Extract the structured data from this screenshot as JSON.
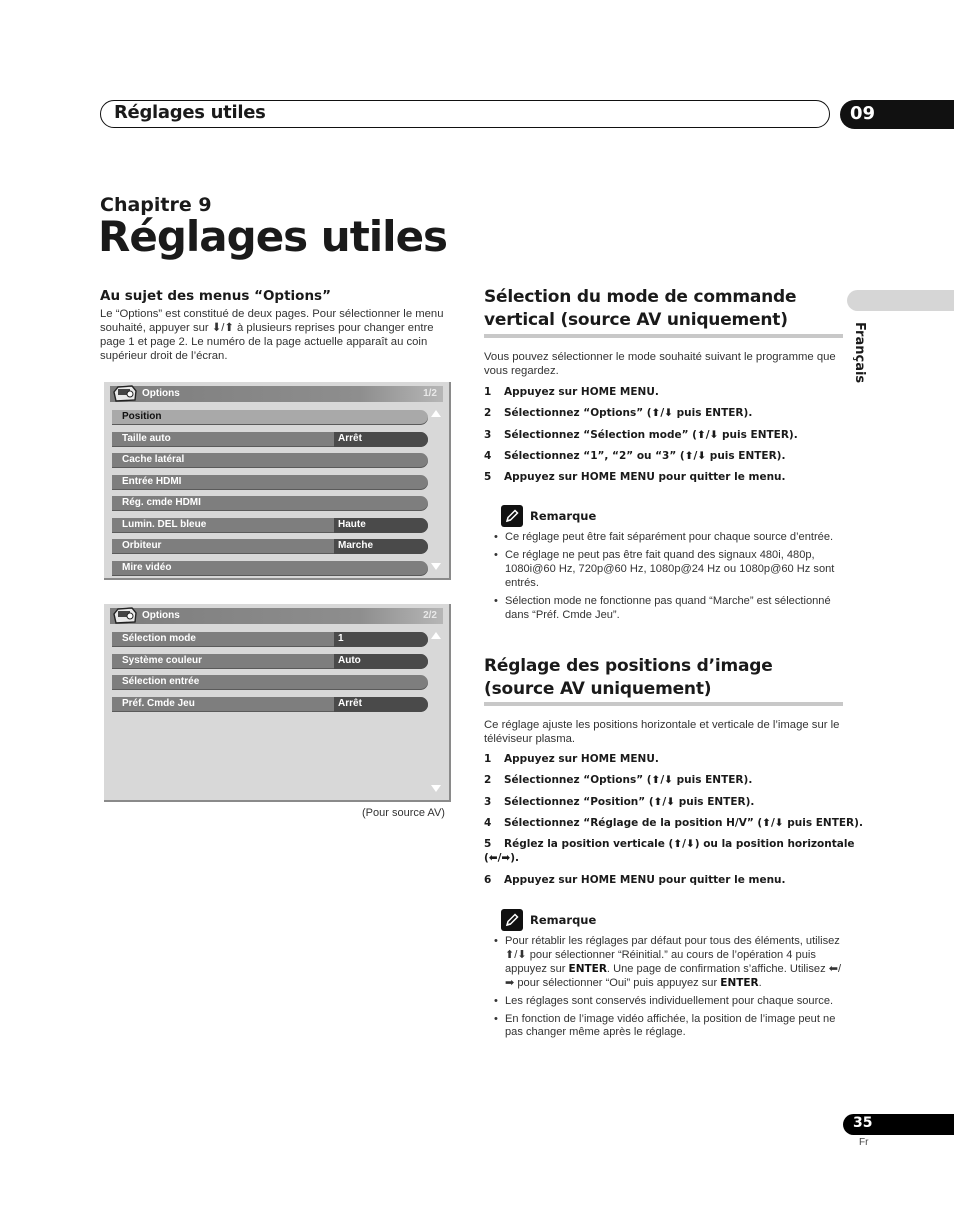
{
  "header": {
    "section_title": "Réglages utiles",
    "chapter_number": "09"
  },
  "chapter": {
    "label": "Chapitre 9",
    "title": "Réglages utiles"
  },
  "side_tab": {
    "language": "Français"
  },
  "left": {
    "heading": "Au sujet des menus “Options”",
    "paragraph": "Le “Options” est constitué de deux pages. Pour sélectionner le menu souhaité, appuyer sur ⬇/⬆ à plusieurs reprises pour changer entre page 1 et page 2. Le numéro de la page actuelle apparaît au coin supérieur droit de l’écran.",
    "menus": [
      {
        "title": "Options",
        "page": "1/2",
        "icon": "remote-control-icon",
        "rows": [
          {
            "label": "Position",
            "value": null,
            "selected": true
          },
          {
            "label": "Taille auto",
            "value": "Arrêt"
          },
          {
            "label": "Cache latéral",
            "value": null
          },
          {
            "label": "Entrée HDMI",
            "value": null
          },
          {
            "label": "Rég. cmde HDMI",
            "value": null
          },
          {
            "label": "Lumin. DEL bleue",
            "value": "Haute"
          },
          {
            "label": "Orbiteur",
            "value": "Marche"
          },
          {
            "label": "Mire vidéo",
            "value": null
          }
        ]
      },
      {
        "title": "Options",
        "page": "2/2",
        "icon": "remote-control-icon",
        "rows": [
          {
            "label": "Sélection mode",
            "value": "1"
          },
          {
            "label": "Système couleur",
            "value": "Auto"
          },
          {
            "label": "Sélection entrée",
            "value": null
          },
          {
            "label": "Préf. Cmde Jeu",
            "value": "Arrêt"
          }
        ]
      }
    ],
    "caption": "(Pour source AV)"
  },
  "right": {
    "section1": {
      "title_line1": "Sélection du mode de commande",
      "title_line2": "vertical (source AV uniquement)",
      "intro": "Vous pouvez sélectionner le mode souhaité suivant le programme que vous regardez.",
      "steps": [
        {
          "n": "1",
          "text": "Appuyez sur HOME MENU."
        },
        {
          "n": "2",
          "text": "Sélectionnez “Options” (⬆/⬇ puis ENTER)."
        },
        {
          "n": "3",
          "text": "Sélectionnez “Sélection mode” (⬆/⬇ puis ENTER)."
        },
        {
          "n": "4",
          "text": "Sélectionnez “1”, “2” ou “3” (⬆/⬇ puis ENTER)."
        },
        {
          "n": "5",
          "text": "Appuyez sur HOME MENU pour quitter le menu."
        }
      ],
      "note_heading": "Remarque",
      "notes": [
        "Ce réglage peut être fait séparément pour chaque source d’entrée.",
        "Ce réglage ne peut pas être fait quand des signaux 480i, 480p, 1080i@60 Hz, 720p@60 Hz, 1080p@24 Hz ou 1080p@60 Hz sont entrés.",
        "Sélection mode ne fonctionne pas quand “Marche” est sélectionné dans “Préf. Cmde Jeu”."
      ]
    },
    "section2": {
      "title_line1": "Réglage des positions d’image",
      "title_line2": "(source AV uniquement)",
      "intro": "Ce réglage ajuste les positions horizontale et verticale de l’image sur le téléviseur plasma.",
      "steps": [
        {
          "n": "1",
          "text": "Appuyez sur HOME MENU."
        },
        {
          "n": "2",
          "text": "Sélectionnez “Options” (⬆/⬇ puis ENTER)."
        },
        {
          "n": "3",
          "text": "Sélectionnez “Position” (⬆/⬇ puis ENTER)."
        },
        {
          "n": "4",
          "text": "Sélectionnez “Réglage de la position H/V” (⬆/⬇ puis ENTER)."
        },
        {
          "n": "5",
          "text": "Réglez la position verticale (⬆/⬇) ou la position horizontale"
        },
        {
          "n": "",
          "text": "(⬅/➡)."
        },
        {
          "n": "6",
          "text": "Appuyez sur HOME MENU pour quitter le menu."
        }
      ],
      "note_heading": "Remarque",
      "note1_part1": "Pour rétablir les réglages par défaut pour tous des éléments, utilisez ⬆/⬇ pour sélectionner “Réinitial.” au cours de l’opération 4 puis appuyez sur ",
      "note1_kw1": "ENTER",
      "note1_part2": ". Une page de confirmation s’affiche. Utilisez ⬅/➡ pour sélectionner “Oui” puis appuyez sur ",
      "note1_kw2": "ENTER",
      "note1_part3": ".",
      "notes": [
        "Les réglages sont conservés individuellement pour chaque source.",
        "En fonction de l’image vidéo affichée, la position de l’image peut ne pas changer même après le réglage."
      ]
    }
  },
  "footer": {
    "page_number": "35",
    "language_code": "Fr"
  }
}
